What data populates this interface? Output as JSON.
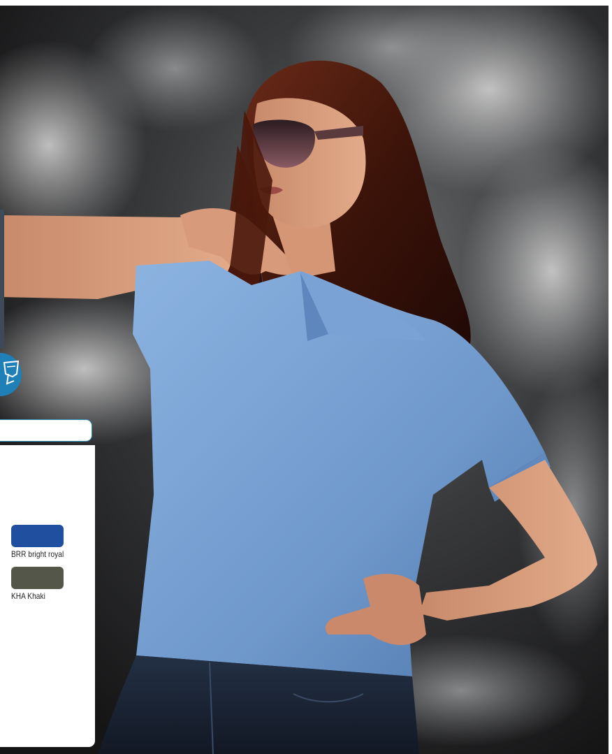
{
  "colors": {
    "background": "#2e2f31",
    "shirt": "#7fa7d6",
    "accent_blue": "#2a8fbf"
  },
  "swatches": [
    {
      "code_name": "BRR bright royal",
      "color": "#1f4f9e"
    },
    {
      "code_name": "KHA Khaki",
      "color": "#545649"
    }
  ],
  "badge_icon": "tshirt-icon"
}
